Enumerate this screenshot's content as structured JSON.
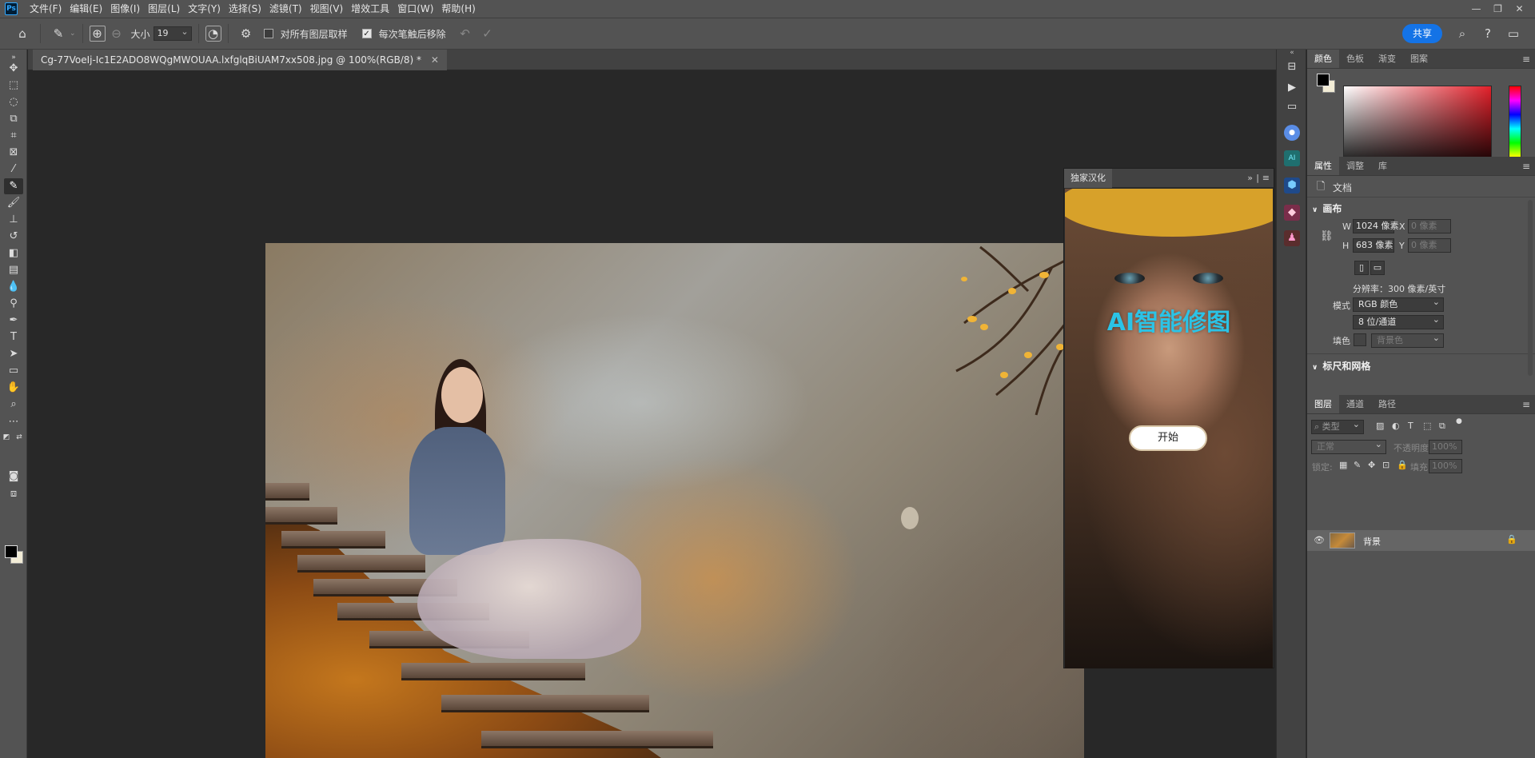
{
  "menu": {
    "app_logo": "Ps",
    "items": [
      "文件(F)",
      "编辑(E)",
      "图像(I)",
      "图层(L)",
      "文字(Y)",
      "选择(S)",
      "滤镜(T)",
      "视图(V)",
      "增效工具",
      "窗口(W)",
      "帮助(H)"
    ]
  },
  "options_bar": {
    "size_label": "大小",
    "size_value": "19",
    "sample_all_layers": "对所有图层取样",
    "remove_after_stroke": "每次笔触后移除",
    "share_label": "共享"
  },
  "document": {
    "tab_title": "Cg-77VoeIj-Ic1E2ADO8WQgMWOUAA.lxfglqBiUAM7xx508.jpg @ 100%(RGB/8) *"
  },
  "plugin": {
    "tab_label": "独家汉化",
    "title": "AI智能修图",
    "start_button": "开始"
  },
  "color_panel": {
    "tabs": [
      "颜色",
      "色板",
      "渐变",
      "图案"
    ],
    "foreground": "#000000",
    "background": "#f2ecd6"
  },
  "properties_panel": {
    "tabs": [
      "属性",
      "调整",
      "库"
    ],
    "doc_label": "文档",
    "canvas_section": "画布",
    "w_label": "W",
    "w_value": "1024 像素",
    "h_label": "H",
    "h_value": "683 像素",
    "x_label": "X",
    "x_value": "0 像素",
    "y_label": "Y",
    "y_value": "0 像素",
    "resolution": "分辨率：300 像素/英寸",
    "mode_label": "模式",
    "mode_value": "RGB 颜色",
    "depth_value": "8 位/通道",
    "fill_label": "填色",
    "fill_value": "背景色",
    "rulers_section": "标尺和网格"
  },
  "layers_panel": {
    "tabs": [
      "图层",
      "通道",
      "路径"
    ],
    "search_placeholder": "类型",
    "blend_mode": "正常",
    "opacity_label": "不透明度:",
    "opacity_value": "100%",
    "lock_label": "锁定:",
    "fill_label": "填充:",
    "fill_value": "100%",
    "layer_name": "背景"
  }
}
